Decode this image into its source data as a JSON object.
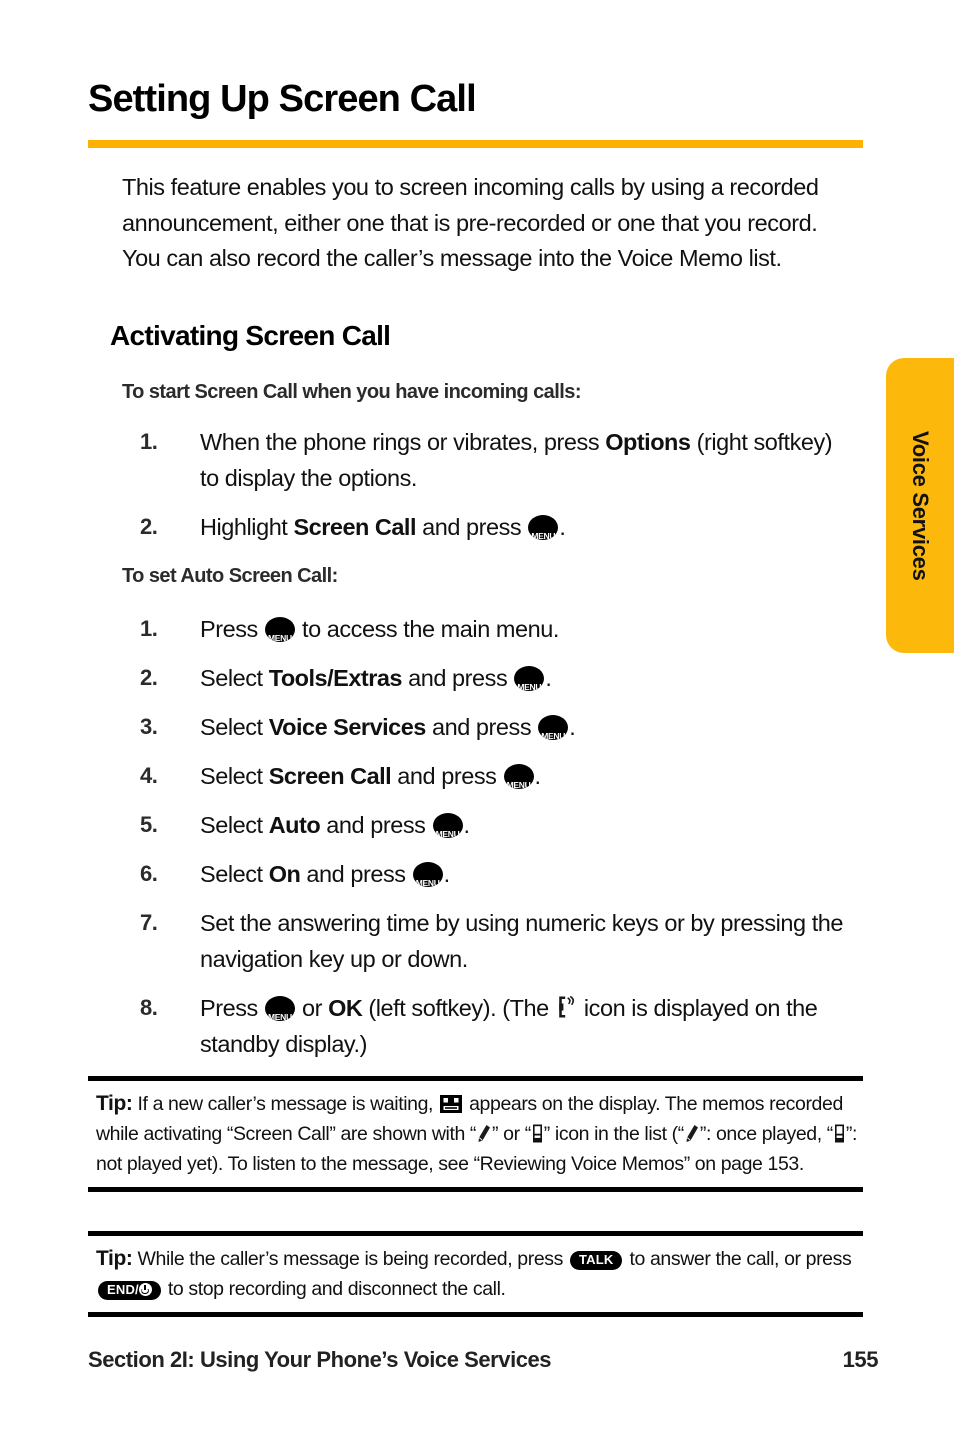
{
  "page": {
    "title": "Setting Up Screen Call",
    "accent_color": "#FDB100",
    "tab_color": "#FDB80C"
  },
  "intro": {
    "text": "This feature enables you to screen incoming calls by using a recorded announcement, either one that is pre-recorded or one that you record. You can also record the caller’s message into the Voice Memo list."
  },
  "section": {
    "heading": "Activating Screen Call"
  },
  "subheads": {
    "start": "To start Screen Call when you have incoming calls:",
    "auto": "To set Auto Screen Call:"
  },
  "list_start": [
    {
      "num": "1.",
      "pre": "When the phone rings or vibrates, press ",
      "bold": "Options",
      "post": " (right softkey) to display the options."
    },
    {
      "num": "2.",
      "pre": "Highlight ",
      "bold": "Screen Call",
      "post": " and press ",
      "icon": "menu-ok-key",
      "tail": "."
    }
  ],
  "list_auto": [
    {
      "num": "1.",
      "pre": "Press ",
      "icon": "menu-ok-key",
      "post": " to access the main menu."
    },
    {
      "num": "2.",
      "pre": "Select ",
      "bold": "Tools/Extras",
      "mid": " and press ",
      "icon": "menu-ok-key",
      "tail": "."
    },
    {
      "num": "3.",
      "pre": "Select ",
      "bold": "Voice Services",
      "mid": " and press ",
      "icon": "menu-ok-key",
      "tail": "."
    },
    {
      "num": "4.",
      "pre": "Select ",
      "bold": "Screen Call",
      "mid": " and press ",
      "icon": "menu-ok-key",
      "tail": "."
    },
    {
      "num": "5.",
      "pre": "Select ",
      "bold": "Auto",
      "mid": " and press ",
      "icon": "menu-ok-key",
      "tail": "."
    },
    {
      "num": "6.",
      "pre": "Select ",
      "bold": "On",
      "mid": " and press ",
      "icon": "menu-ok-key",
      "tail": "."
    },
    {
      "num": "7.",
      "pre": "Set the answering time by using numeric keys or by pressing the navigation key up or down."
    },
    {
      "num": "8.",
      "pre": "Press ",
      "icon": "menu-ok-key",
      "mid": " or ",
      "bold": "OK",
      "mid2": " (left softkey). (The ",
      "icon2": "screen-call-standby-icon",
      "tail": " icon is displayed on the standby display.)"
    }
  ],
  "key_icons": {
    "menu_ok_line1": "MENU",
    "menu_ok_line2": "OK",
    "talk_label": "TALK",
    "end_label": "END/"
  },
  "tips": [
    {
      "label": "Tip:",
      "seg1": " If a new caller’s message is waiting, ",
      "icon1": "new-message-icon",
      "seg2": " appears on the display. The memos recorded while activating “Screen Call” are shown with “",
      "icon2": "memo-played-icon",
      "seg3": "” or “",
      "icon3": "memo-not-played-icon",
      "seg4": "” icon in the list (“",
      "icon4": "memo-played-icon",
      "seg5": "”: once played, “",
      "icon5": "memo-not-played-icon",
      "seg6": "”: not played yet). To listen to the message, see “Reviewing Voice Memos” on page 153."
    },
    {
      "label": "Tip:",
      "seg1": " While the caller’s message is being recorded, press ",
      "icon1": "talk-key",
      "seg2": " to answer the call, or press ",
      "icon2": "end-power-key",
      "seg3": " to stop recording and disconnect the call."
    }
  ],
  "footer": {
    "section_label": "Section 2I: Using Your Phone’s Voice Services",
    "page_number": "155"
  },
  "side_tab": {
    "label": "Voice Services"
  }
}
